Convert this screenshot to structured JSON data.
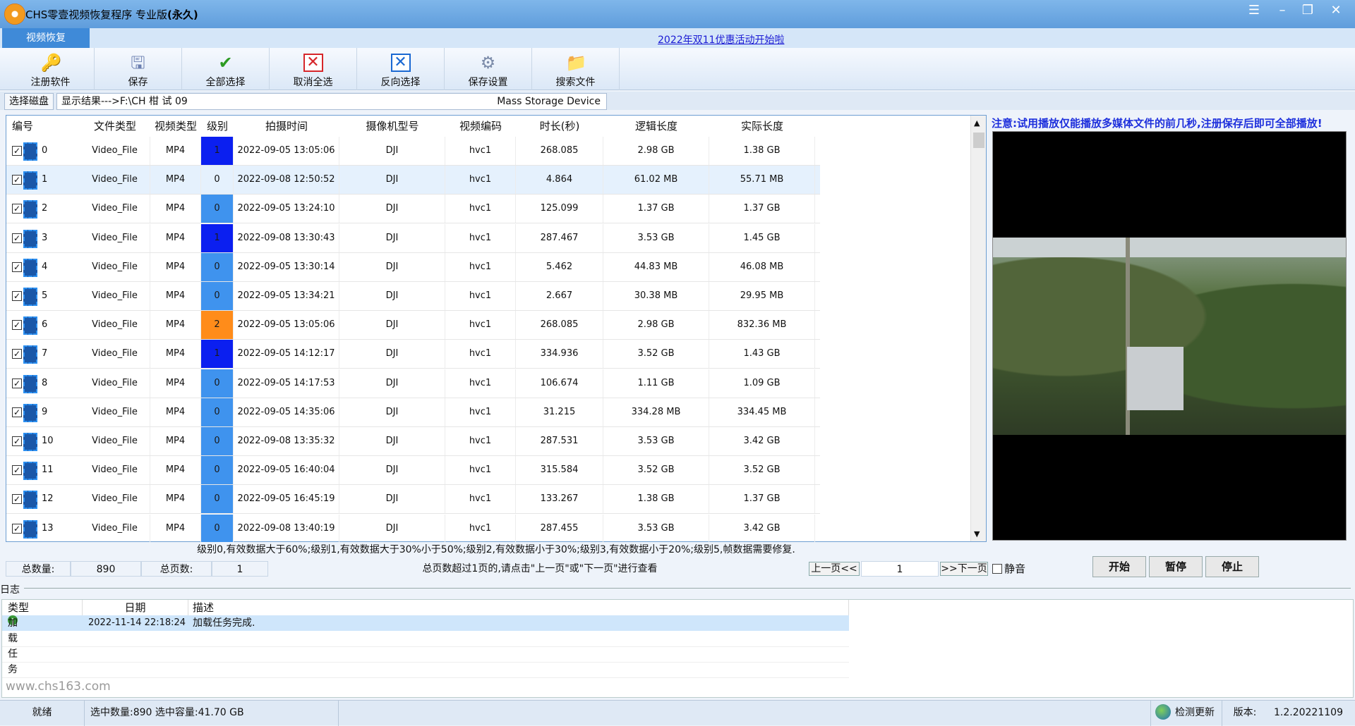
{
  "window": {
    "title_prefix": "CHS零壹视频恢复程序 专业版",
    "title_suffix": "(永久)"
  },
  "tabs": {
    "main_tab": "视频恢复",
    "promo_link": "2022年双11优惠活动开始啦"
  },
  "toolbar": {
    "items": [
      {
        "label": "注册软件",
        "icon": "key-icon"
      },
      {
        "label": "保存",
        "icon": "save-icon"
      },
      {
        "label": "全部选择",
        "icon": "check-icon"
      },
      {
        "label": "取消全选",
        "icon": "x-red-icon"
      },
      {
        "label": "反向选择",
        "icon": "x-blue-icon"
      },
      {
        "label": "保存设置",
        "icon": "settings-icon"
      },
      {
        "label": "搜索文件",
        "icon": "folder-search-icon"
      }
    ]
  },
  "subtabs": {
    "select_disk": "选择磁盘",
    "result_path": "显示结果--->F:\\CH     柑   试   09         ",
    "device": "Mass Storage Device"
  },
  "table": {
    "headers": [
      "编号",
      "文件类型",
      "视频类型",
      "级别",
      "拍摄时间",
      "摄像机型号",
      "视频编码",
      "时长(秒)",
      "逻辑长度",
      "实际长度"
    ],
    "level_colors": {
      "0": "#3f93ee",
      "1": "#0b1ff0",
      "2": "#ff8c1a"
    },
    "rows": [
      {
        "id": "0",
        "file_type": "Video_File",
        "video_type": "MP4",
        "level": "1",
        "level_color": "#0b1ff0",
        "time": "2022-09-05 13:05:06",
        "camera": "DJI",
        "codec": "hvc1",
        "duration": "268.085",
        "logical": "2.98 GB",
        "actual": "1.38 GB"
      },
      {
        "id": "1",
        "file_type": "Video_File",
        "video_type": "MP4",
        "level": "0",
        "level_color": "",
        "time": "2022-09-08 12:50:52",
        "camera": "DJI",
        "codec": "hvc1",
        "duration": "4.864",
        "logical": "61.02 MB",
        "actual": "55.71 MB",
        "selected": true
      },
      {
        "id": "2",
        "file_type": "Video_File",
        "video_type": "MP4",
        "level": "0",
        "level_color": "#3f93ee",
        "time": "2022-09-05 13:24:10",
        "camera": "DJI",
        "codec": "hvc1",
        "duration": "125.099",
        "logical": "1.37 GB",
        "actual": "1.37 GB"
      },
      {
        "id": "3",
        "file_type": "Video_File",
        "video_type": "MP4",
        "level": "1",
        "level_color": "#0b1ff0",
        "time": "2022-09-08 13:30:43",
        "camera": "DJI",
        "codec": "hvc1",
        "duration": "287.467",
        "logical": "3.53 GB",
        "actual": "1.45 GB"
      },
      {
        "id": "4",
        "file_type": "Video_File",
        "video_type": "MP4",
        "level": "0",
        "level_color": "#3f93ee",
        "time": "2022-09-05 13:30:14",
        "camera": "DJI",
        "codec": "hvc1",
        "duration": "5.462",
        "logical": "44.83 MB",
        "actual": "46.08 MB"
      },
      {
        "id": "5",
        "file_type": "Video_File",
        "video_type": "MP4",
        "level": "0",
        "level_color": "#3f93ee",
        "time": "2022-09-05 13:34:21",
        "camera": "DJI",
        "codec": "hvc1",
        "duration": "2.667",
        "logical": "30.38 MB",
        "actual": "29.95 MB"
      },
      {
        "id": "6",
        "file_type": "Video_File",
        "video_type": "MP4",
        "level": "2",
        "level_color": "#ff8c1a",
        "time": "2022-09-05 13:05:06",
        "camera": "DJI",
        "codec": "hvc1",
        "duration": "268.085",
        "logical": "2.98 GB",
        "actual": "832.36 MB"
      },
      {
        "id": "7",
        "file_type": "Video_File",
        "video_type": "MP4",
        "level": "1",
        "level_color": "#0b1ff0",
        "time": "2022-09-05 14:12:17",
        "camera": "DJI",
        "codec": "hvc1",
        "duration": "334.936",
        "logical": "3.52 GB",
        "actual": "1.43 GB"
      },
      {
        "id": "8",
        "file_type": "Video_File",
        "video_type": "MP4",
        "level": "0",
        "level_color": "#3f93ee",
        "time": "2022-09-05 14:17:53",
        "camera": "DJI",
        "codec": "hvc1",
        "duration": "106.674",
        "logical": "1.11 GB",
        "actual": "1.09 GB"
      },
      {
        "id": "9",
        "file_type": "Video_File",
        "video_type": "MP4",
        "level": "0",
        "level_color": "#3f93ee",
        "time": "2022-09-05 14:35:06",
        "camera": "DJI",
        "codec": "hvc1",
        "duration": "31.215",
        "logical": "334.28 MB",
        "actual": "334.45 MB"
      },
      {
        "id": "10",
        "file_type": "Video_File",
        "video_type": "MP4",
        "level": "0",
        "level_color": "#3f93ee",
        "time": "2022-09-08 13:35:32",
        "camera": "DJI",
        "codec": "hvc1",
        "duration": "287.531",
        "logical": "3.53 GB",
        "actual": "3.42 GB"
      },
      {
        "id": "11",
        "file_type": "Video_File",
        "video_type": "MP4",
        "level": "0",
        "level_color": "#3f93ee",
        "time": "2022-09-05 16:40:04",
        "camera": "DJI",
        "codec": "hvc1",
        "duration": "315.584",
        "logical": "3.52 GB",
        "actual": "3.52 GB"
      },
      {
        "id": "12",
        "file_type": "Video_File",
        "video_type": "MP4",
        "level": "0",
        "level_color": "#3f93ee",
        "time": "2022-09-05 16:45:19",
        "camera": "DJI",
        "codec": "hvc1",
        "duration": "133.267",
        "logical": "1.38 GB",
        "actual": "1.37 GB"
      },
      {
        "id": "13",
        "file_type": "Video_File",
        "video_type": "MP4",
        "level": "0",
        "level_color": "#3f93ee",
        "time": "2022-09-08 13:40:19",
        "camera": "DJI",
        "codec": "hvc1",
        "duration": "287.455",
        "logical": "3.53 GB",
        "actual": "3.42 GB"
      }
    ]
  },
  "legend": "级别0,有效数据大于60%;级别1,有效数据大于30%小于50%;级别2,有效数据小于30%;级别3,有效数据小于20%;级别5,帧数据需要修复.",
  "pager": {
    "total_count_label": "总数量:",
    "total_count": "890",
    "total_pages_label": "总页数:",
    "total_pages": "1",
    "hint": "总页数超过1页的,请点击\"上一页\"或\"下一页\"进行查看",
    "prev": "上一页<<",
    "page": "1",
    "next": ">>下一页"
  },
  "player": {
    "notice": "注意:试用播放仅能播放多媒体文件的前几秒,注册保存后即可全部播放!",
    "mute": "静音",
    "start": "开始",
    "pause": "暂停",
    "stop": "停止"
  },
  "log": {
    "section": "日志",
    "headers": [
      "类型",
      "日期",
      "描述"
    ],
    "rows": [
      {
        "type": "加载任务",
        "date": "2022-11-14 22:18:24",
        "desc": "加载任务完成."
      }
    ],
    "watermark": "www.chs163.com"
  },
  "status": {
    "ready": "就绪",
    "selection": "选中数量:890 选中容量:41.70 GB",
    "update": "检测更新",
    "version_label": "版本:",
    "version": "1.2.20221109"
  }
}
